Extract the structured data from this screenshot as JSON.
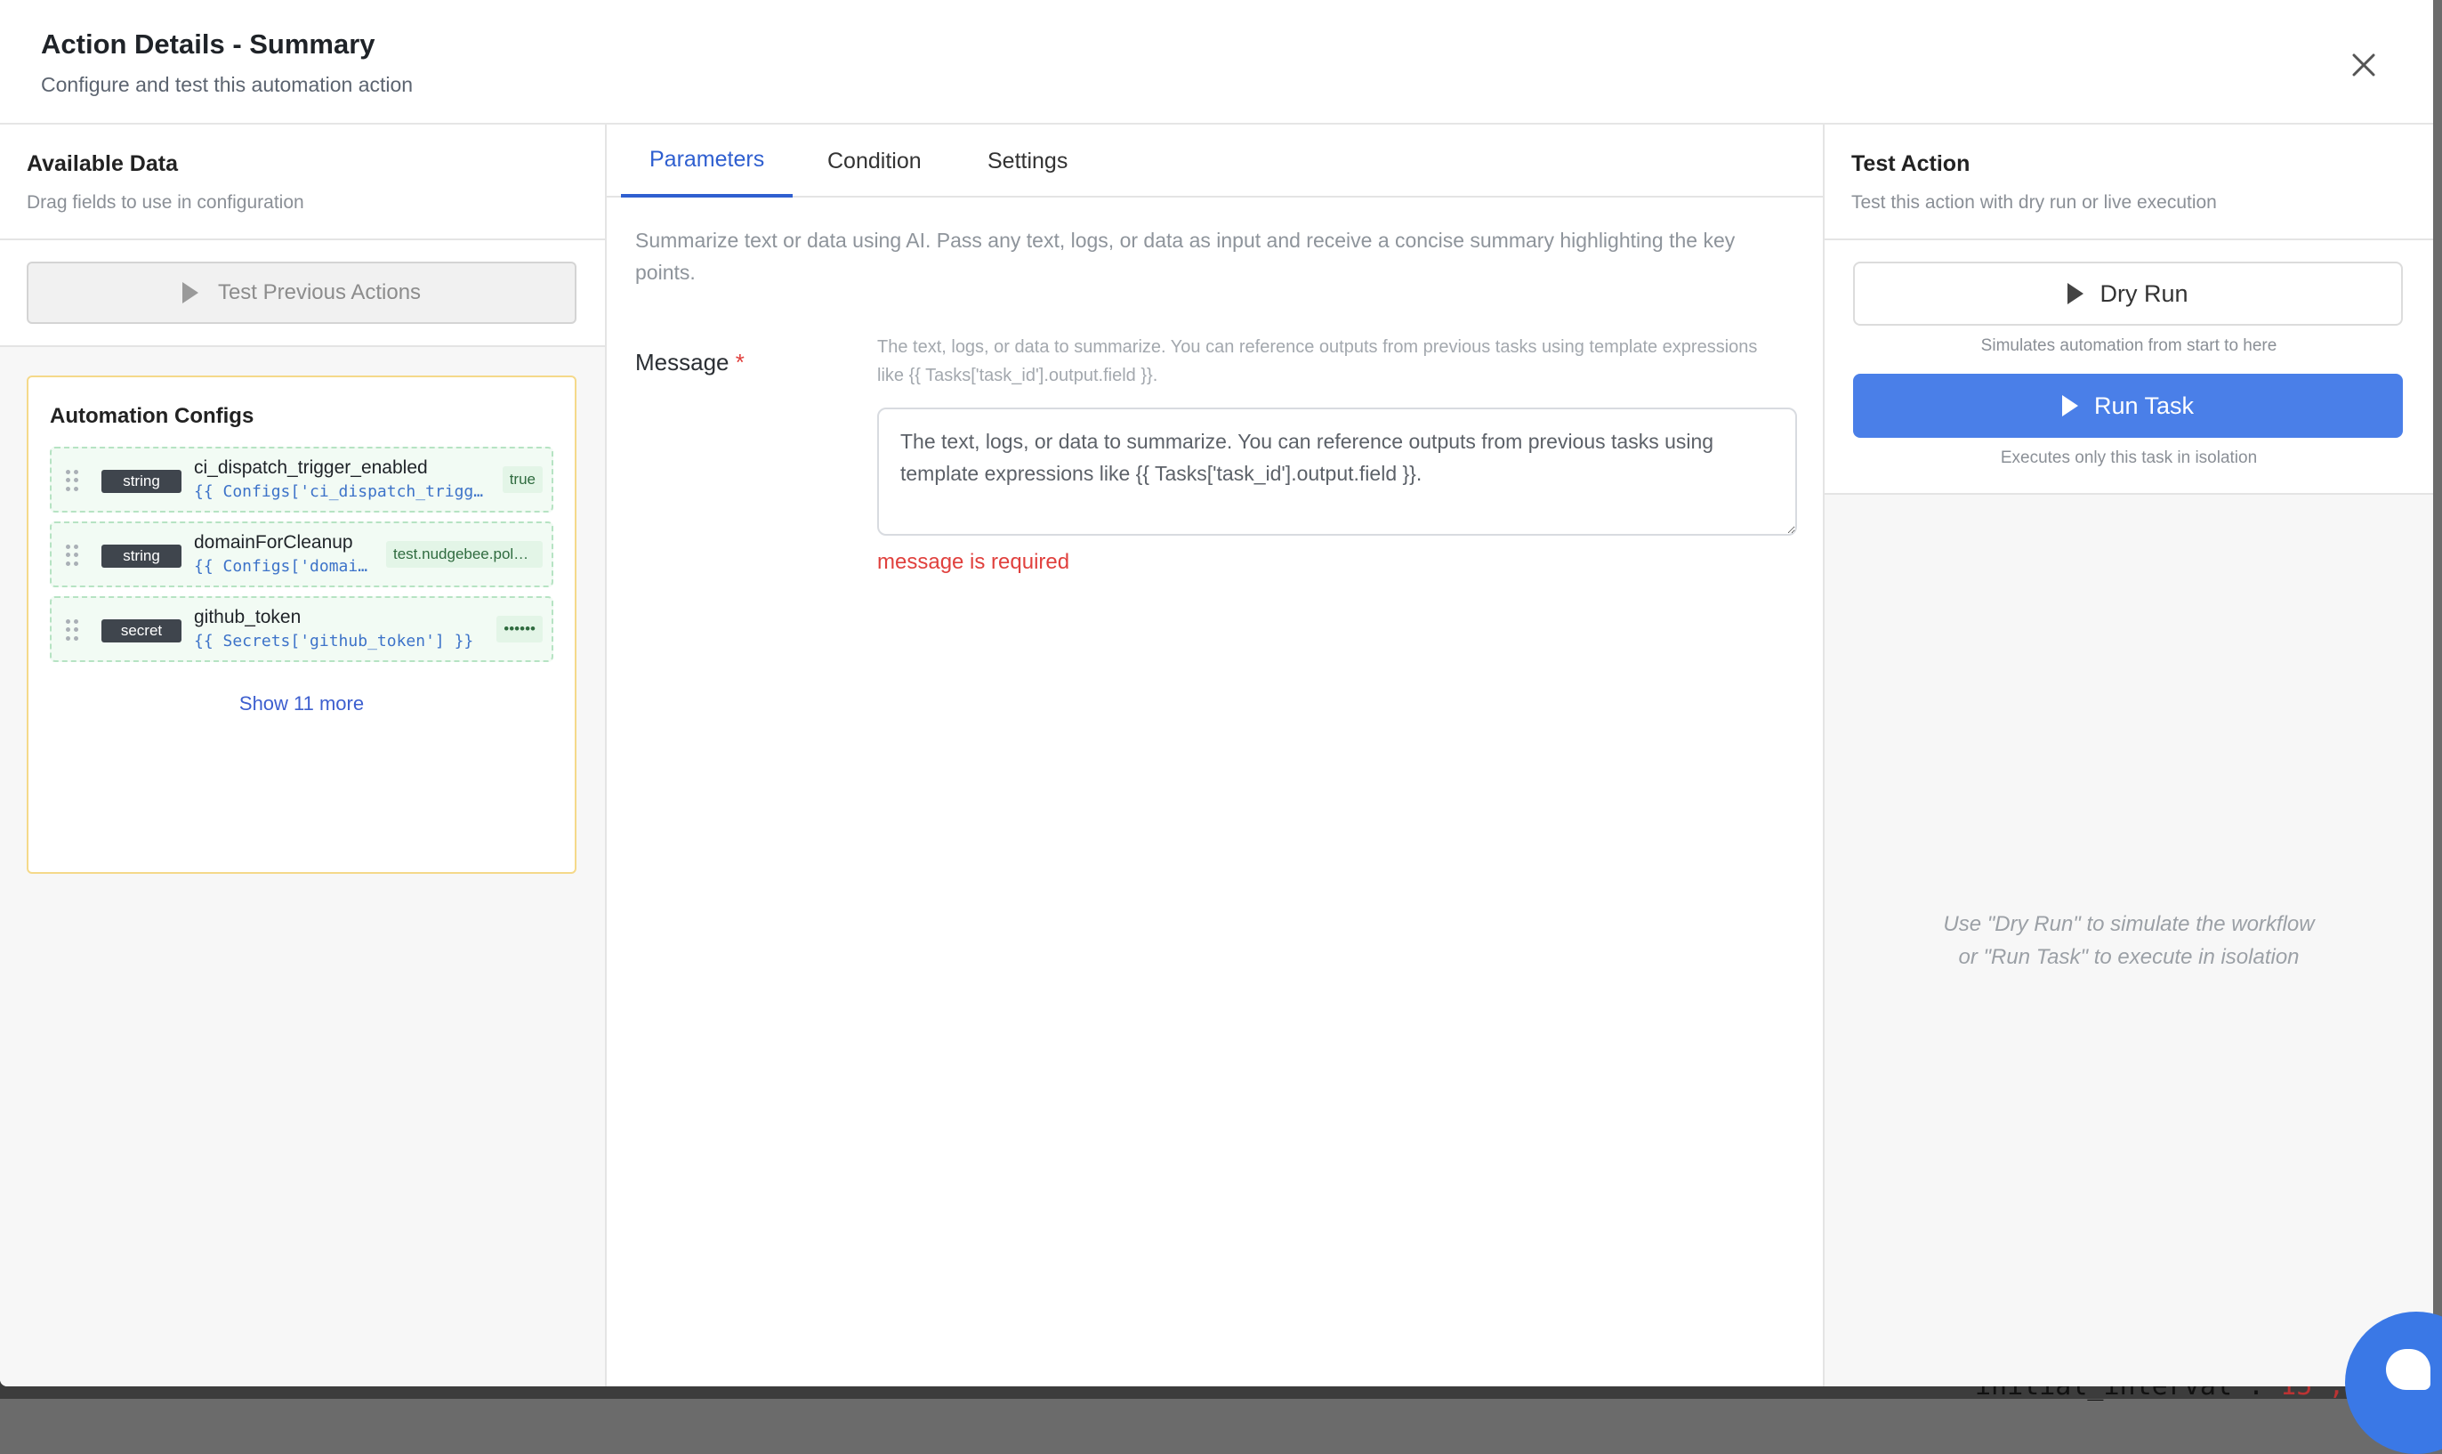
{
  "header": {
    "title": "Action Details - Summary",
    "subtitle": "Configure and test this automation action",
    "close_icon": "close-icon"
  },
  "left": {
    "title": "Available Data",
    "subtitle": "Drag fields to use in configuration",
    "test_previous_label": "Test Previous Actions",
    "configs": {
      "title": "Automation Configs",
      "items": [
        {
          "type": "string",
          "name": "ci_dispatch_trigger_enabled",
          "expr": "{{ Configs['ci_dispatch_trigg…",
          "value": "true"
        },
        {
          "type": "string",
          "name": "domainForCleanup",
          "expr": "{{ Configs['domai…",
          "value": "test.nudgebee.pol…"
        },
        {
          "type": "secret",
          "name": "github_token",
          "expr": "{{ Secrets['github_token'] }}",
          "value": "••••••"
        }
      ],
      "show_more": "Show 11 more"
    }
  },
  "middle": {
    "tabs": [
      {
        "label": "Parameters",
        "active": true
      },
      {
        "label": "Condition",
        "active": false
      },
      {
        "label": "Settings",
        "active": false
      }
    ],
    "description": "Summarize text or data using AI. Pass any text, logs, or data as input and receive a concise summary highlighting the key points.",
    "message_field": {
      "label": "Message",
      "required_mark": "*",
      "help": "The text, logs, or data to summarize. You can reference outputs from previous tasks using template expressions like {{ Tasks['task_id'].output.field }}.",
      "value": "The text, logs, or data to summarize. You can reference outputs from previous tasks using template expressions like {{ Tasks['task_id'].output.field }}.",
      "error": "message is required"
    }
  },
  "right": {
    "title": "Test Action",
    "subtitle": "Test this action with dry run or live execution",
    "dry_run_label": "Dry Run",
    "dry_run_hint": "Simulates automation from start to here",
    "run_task_label": "Run Task",
    "run_task_hint": "Executes only this task in isolation",
    "empty_line1": "Use \"Dry Run\" to simulate the workflow",
    "empty_line2": "or \"Run Task\" to execute in isolation"
  },
  "backdrop": {
    "code_text": "initial_interval': ",
    "code_num": "15',"
  },
  "colors": {
    "accent": "#2f5fd0",
    "run_button": "#4a7fe8",
    "error": "#e0403d",
    "config_border": "#f5d98a"
  }
}
